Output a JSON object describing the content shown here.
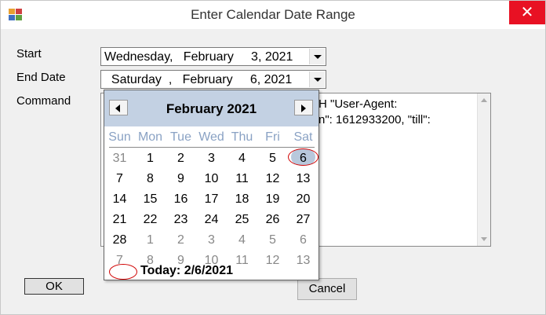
{
  "window": {
    "title": "Enter Calendar Date Range",
    "close_glyph": "✕"
  },
  "form": {
    "start_label": "Start",
    "end_label": "End Date",
    "command_label": "Command",
    "start_value": "Wednesday,   February     3, 2021",
    "end_value": "  Saturday  ,   February     6, 2021",
    "command_text": "H \"User-Agent:\nn\": 1612933200, \"till\":",
    "ok_label": "OK",
    "cancel_label": "Cancel"
  },
  "calendar": {
    "month_title": "February 2021",
    "days_of_week": [
      "Sun",
      "Mon",
      "Tue",
      "Wed",
      "Thu",
      "Fri",
      "Sat"
    ],
    "weeks": [
      [
        "31",
        "1",
        "2",
        "3",
        "4",
        "5",
        "6"
      ],
      [
        "7",
        "8",
        "9",
        "10",
        "11",
        "12",
        "13"
      ],
      [
        "14",
        "15",
        "16",
        "17",
        "18",
        "19",
        "20"
      ],
      [
        "21",
        "22",
        "23",
        "24",
        "25",
        "26",
        "27"
      ],
      [
        "28",
        "1",
        "2",
        "3",
        "4",
        "5",
        "6"
      ],
      [
        "7",
        "8",
        "9",
        "10",
        "11",
        "12",
        "13"
      ]
    ],
    "other_month": [
      [
        true,
        false,
        false,
        false,
        false,
        false,
        false
      ],
      [
        false,
        false,
        false,
        false,
        false,
        false,
        false
      ],
      [
        false,
        false,
        false,
        false,
        false,
        false,
        false
      ],
      [
        false,
        false,
        false,
        false,
        false,
        false,
        false
      ],
      [
        false,
        true,
        true,
        true,
        true,
        true,
        true
      ],
      [
        true,
        true,
        true,
        true,
        true,
        true,
        true
      ]
    ],
    "selected_day": "6",
    "today_label": "Today: 2/6/2021"
  },
  "colors": {
    "header_bg": "#c3d1e3",
    "dow_text": "#8aa2c4",
    "annotation_red": "#d00000",
    "close_red": "#e81123"
  },
  "icons": {
    "app": "app-icon",
    "prev": "chevron-left-icon",
    "next": "chevron-right-icon",
    "dropdown": "chevron-down-icon"
  }
}
